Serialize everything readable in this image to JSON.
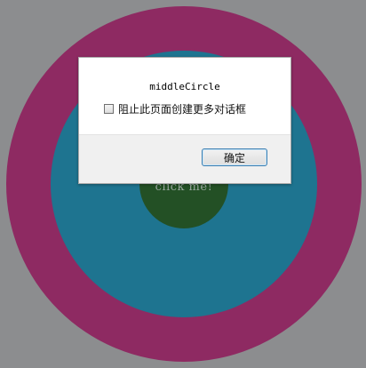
{
  "page": {
    "inner_circle_text": "click me!"
  },
  "dialog": {
    "message": "middleCircle",
    "suppress_label": "阻止此页面创建更多对话框",
    "suppress_checked": false,
    "ok_label": "确定"
  },
  "colors": {
    "background": "#8c8d8f",
    "outer_circle": "#8e2a62",
    "middle_circle": "#1e7490",
    "inner_circle": "#235025",
    "button_border": "#3c7fb1"
  }
}
